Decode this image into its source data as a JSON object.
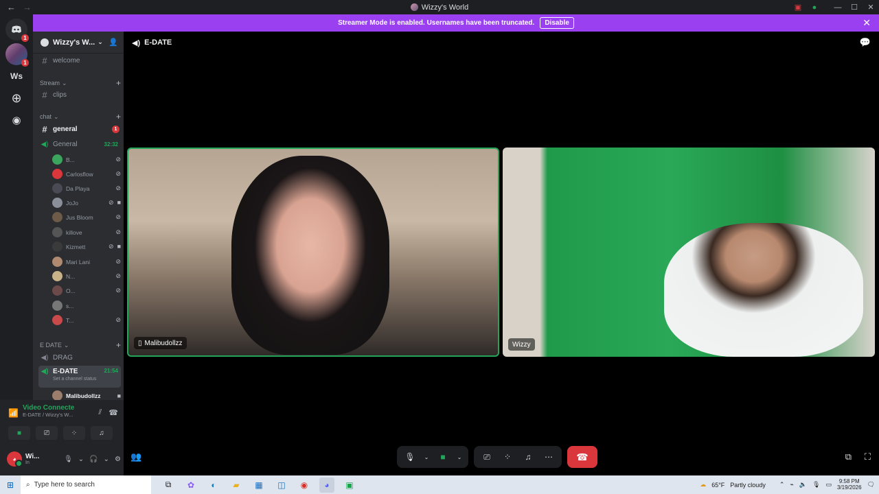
{
  "window": {
    "title": "Wizzy's World",
    "back_icon": "arrow-left-icon",
    "forward_icon": "arrow-right-icon"
  },
  "banner": {
    "text": "Streamer Mode is enabled. Usernames have been truncated.",
    "button": "Disable",
    "color": "#9b40f0"
  },
  "servers": {
    "home_badge": "1",
    "server_badge": "1",
    "ws_label": "Ws"
  },
  "guild": {
    "name": "Wizzy's W..."
  },
  "channels": {
    "welcome": "welcome",
    "cat_stream": "Stream",
    "clips": "clips",
    "cat_chat": "chat",
    "general_text": "general",
    "general_badge": "1",
    "general_voice": "General",
    "general_time": "32:32",
    "cat_edate": "E DATE",
    "drag": "DRAG",
    "edate": "E-DATE",
    "edate_time": "21:54",
    "edate_status": "Set a channel status",
    "edate_user": "Malibudollzz"
  },
  "voice_users": [
    {
      "name": "B..."
    },
    {
      "name": "Carlosflow"
    },
    {
      "name": "Da Playa"
    },
    {
      "name": "JoJo"
    },
    {
      "name": "Jus Bloom"
    },
    {
      "name": "killove"
    },
    {
      "name": "Kizmett"
    },
    {
      "name": "Mari Lani"
    },
    {
      "name": "N..."
    },
    {
      "name": "O..."
    },
    {
      "name": "s..."
    },
    {
      "name": "T..."
    }
  ],
  "voice_panel": {
    "status": "Video Connecte",
    "location": "E-DATE / Wizzy's W...",
    "username": "Wi...",
    "user_status": "In"
  },
  "main": {
    "channel_title": "E-DATE",
    "tile_left_name": "Malibudollzz",
    "tile_right_name": "Wizzy"
  },
  "taskbar": {
    "search_placeholder": "Type here to search",
    "weather": "65°F",
    "weather_desc": "Partly cloudy",
    "time": "9:58 PM",
    "date": "3/19/2026"
  },
  "colors": {
    "accent_green": "#23a55a",
    "danger_red": "#da373c",
    "sidebar_bg": "#2b2d31"
  }
}
